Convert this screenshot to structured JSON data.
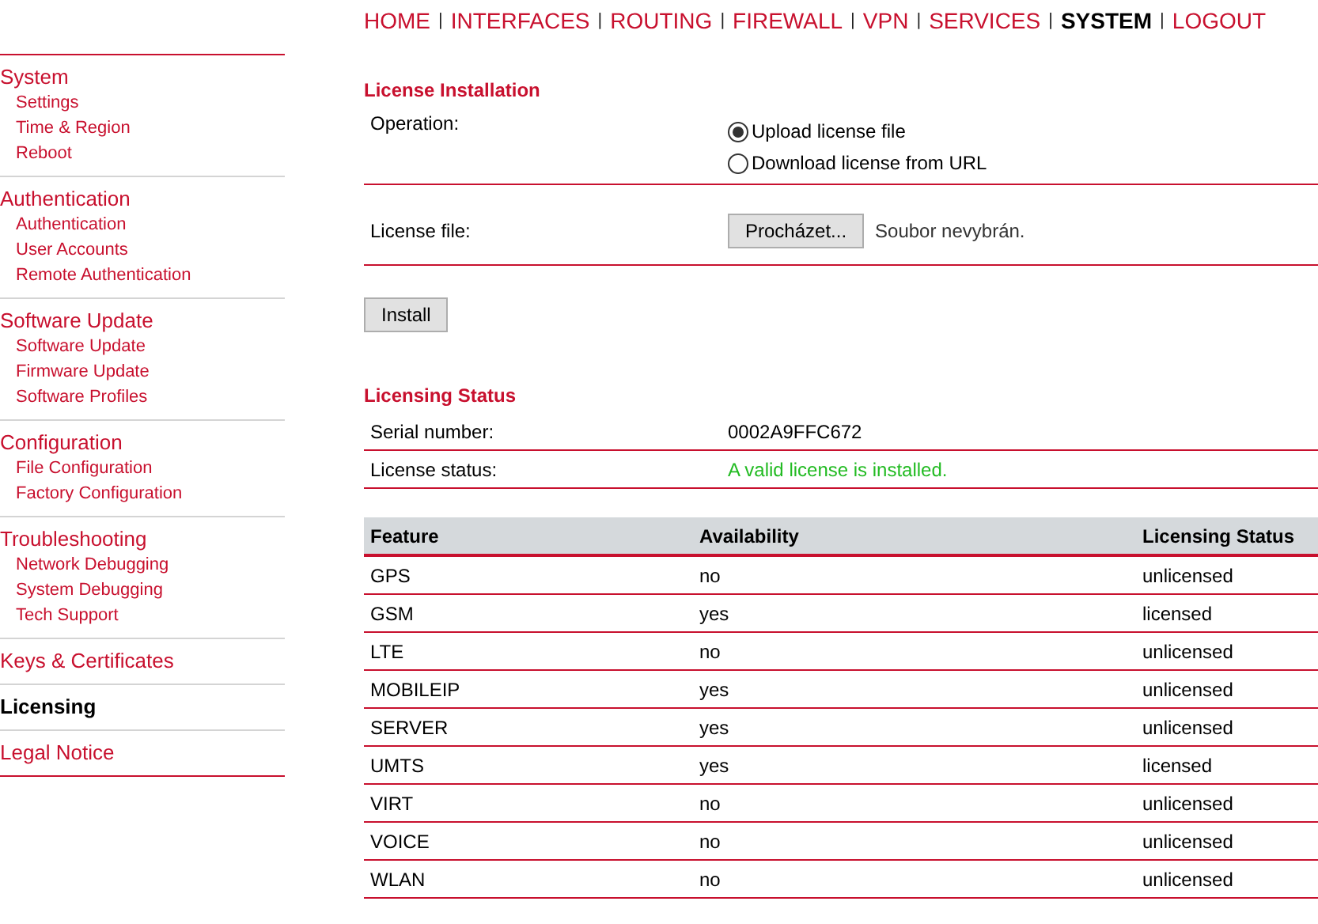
{
  "nav": [
    {
      "label": "HOME",
      "selected": false
    },
    {
      "label": "INTERFACES",
      "selected": false
    },
    {
      "label": "ROUTING",
      "selected": false
    },
    {
      "label": "FIREWALL",
      "selected": false
    },
    {
      "label": "VPN",
      "selected": false
    },
    {
      "label": "SERVICES",
      "selected": false
    },
    {
      "label": "SYSTEM",
      "selected": true
    },
    {
      "label": "LOGOUT",
      "selected": false
    }
  ],
  "nav_separator": "|",
  "sidebar": [
    {
      "label": "System",
      "selected": false,
      "children": [
        {
          "label": "Settings"
        },
        {
          "label": "Time & Region"
        },
        {
          "label": "Reboot"
        }
      ]
    },
    {
      "label": "Authentication",
      "selected": false,
      "children": [
        {
          "label": "Authentication"
        },
        {
          "label": "User Accounts"
        },
        {
          "label": "Remote Authentication"
        }
      ]
    },
    {
      "label": "Software Update",
      "selected": false,
      "children": [
        {
          "label": "Software Update"
        },
        {
          "label": "Firmware Update"
        },
        {
          "label": "Software Profiles"
        }
      ]
    },
    {
      "label": "Configuration",
      "selected": false,
      "children": [
        {
          "label": "File Configuration"
        },
        {
          "label": "Factory Configuration"
        }
      ]
    },
    {
      "label": "Troubleshooting",
      "selected": false,
      "children": [
        {
          "label": "Network Debugging"
        },
        {
          "label": "System Debugging"
        },
        {
          "label": "Tech Support"
        }
      ]
    },
    {
      "label": "Keys & Certificates",
      "selected": false
    },
    {
      "label": "Licensing",
      "selected": true
    },
    {
      "label": "Legal Notice",
      "selected": false
    }
  ],
  "installation": {
    "title": "License Installation",
    "operation_label": "Operation:",
    "options": [
      {
        "label": "Upload license file",
        "selected": true
      },
      {
        "label": "Download license from URL",
        "selected": false
      }
    ],
    "file_label": "License file:",
    "browse_button": "Procházet...",
    "file_status": "Soubor nevybrán.",
    "install_button": "Install"
  },
  "status": {
    "title": "Licensing Status",
    "fields": [
      {
        "label": "Serial number:",
        "value": "0002A9FFC672",
        "kind": "plain"
      },
      {
        "label": "License status:",
        "value": "A valid license is installed.",
        "kind": "ok"
      }
    ]
  },
  "table": {
    "columns": [
      "Feature",
      "Availability",
      "Licensing Status"
    ],
    "rows": [
      [
        "GPS",
        "no",
        "unlicensed"
      ],
      [
        "GSM",
        "yes",
        "licensed"
      ],
      [
        "LTE",
        "no",
        "unlicensed"
      ],
      [
        "MOBILEIP",
        "yes",
        "unlicensed"
      ],
      [
        "SERVER",
        "yes",
        "unlicensed"
      ],
      [
        "UMTS",
        "yes",
        "licensed"
      ],
      [
        "VIRT",
        "no",
        "unlicensed"
      ],
      [
        "VOICE",
        "no",
        "unlicensed"
      ],
      [
        "WLAN",
        "no",
        "unlicensed"
      ]
    ]
  }
}
